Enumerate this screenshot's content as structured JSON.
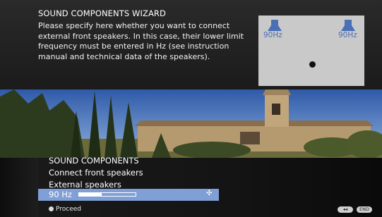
{
  "wizard": {
    "title": "SOUND COMPONENTS WIZARD",
    "description": "Please specify here whether you want to connect external front speakers. In this case, their lower limit frequency must be entered in Hz (see instruction manual and technical data of the speakers)."
  },
  "diagram": {
    "left_freq": "90Hz",
    "right_freq": "90Hz",
    "left_icon": "speaker-icon",
    "right_icon": "speaker-icon",
    "speaker_color": "#4a6fb5"
  },
  "menu": {
    "heading": "SOUND COMPONENTS",
    "item1": "Connect front speakers",
    "item2": "External speakers",
    "selected_value": "90 Hz",
    "slider_level": 0.4,
    "selection_color": "#7f9fd6"
  },
  "footer": {
    "proceed_label": "Proceed",
    "back_label": "◂◂",
    "end_label": "END"
  }
}
